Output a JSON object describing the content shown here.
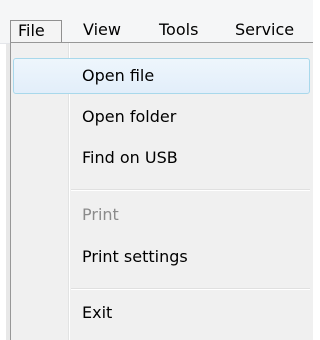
{
  "menubar": {
    "file": "File",
    "view": "View",
    "tools": "Tools",
    "service": "Service"
  },
  "file_menu": {
    "open_file": "Open file",
    "open_folder": "Open folder",
    "find_on_usb": "Find on USB",
    "print": "Print",
    "print_settings": "Print settings",
    "exit": "Exit"
  },
  "colors": {
    "menu_background": "#f0f0f0",
    "highlight_border": "#a8d8eb",
    "disabled_text": "#8b8b8b"
  }
}
